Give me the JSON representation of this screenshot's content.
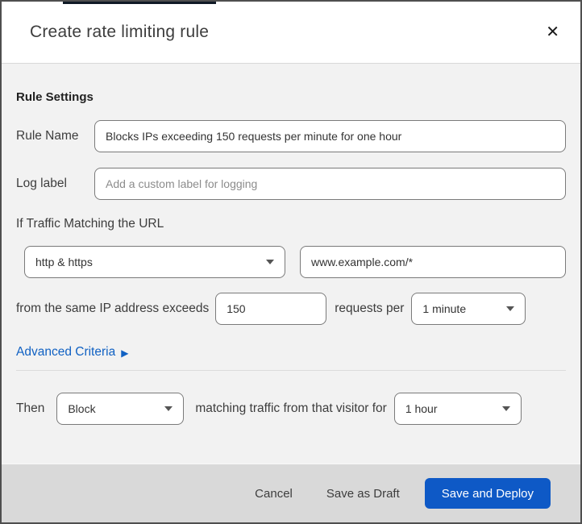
{
  "modal": {
    "title": "Create rate limiting rule",
    "close_icon": "✕"
  },
  "form": {
    "section_heading": "Rule Settings",
    "rule_name": {
      "label": "Rule Name",
      "value": "Blocks IPs exceeding 150 requests per minute for one hour"
    },
    "log_label": {
      "label": "Log label",
      "placeholder": "Add a custom label for logging"
    },
    "traffic_match": {
      "intro": "If Traffic Matching the URL",
      "scheme_selected": "http & https",
      "url_value": "www.example.com/*",
      "threshold_prefix": "from the same IP address exceeds",
      "threshold_value": "150",
      "threshold_suffix": "requests per",
      "period_selected": "1 minute"
    },
    "advanced_criteria": {
      "label": "Advanced Criteria",
      "arrow_icon": "▶"
    },
    "action": {
      "then_label": "Then",
      "action_selected": "Block",
      "middle_text": "matching traffic from that visitor for",
      "duration_selected": "1 hour"
    }
  },
  "footer": {
    "cancel_label": "Cancel",
    "save_draft_label": "Save as Draft",
    "save_deploy_label": "Save and Deploy"
  },
  "colors": {
    "primary_button_blue": "#0e59c6",
    "link_blue": "#1061c3",
    "content_background": "#f2f2f2",
    "footer_background": "#d9d9d9",
    "border_dark": "#4f4f4f",
    "input_border": "#7a7a7a"
  }
}
